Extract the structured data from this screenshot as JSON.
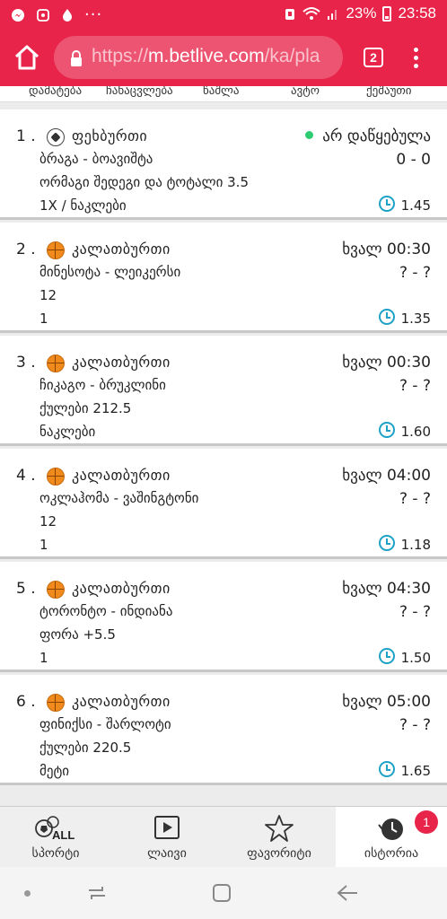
{
  "status_bar": {
    "dots": "···",
    "battery_percent": "23%",
    "time": "23:58"
  },
  "browser": {
    "url_scheme": "https://",
    "url_host": "m.betlive.com",
    "url_path": "/ka/pla",
    "tab_count": "2"
  },
  "sub_header": [
    "დამატება",
    "ჩანაცვლება",
    "წაშლა",
    "ავტო",
    "ქეშაუთი"
  ],
  "bets": [
    {
      "num": "1 .",
      "icon": "soccer-ball-icon",
      "sport": "ფეხბურთი",
      "time": "არ დაწყებულა",
      "live": true,
      "teams": "ბრაგა - ბოავიშტა",
      "score": "0 - 0",
      "market": "ორმაგი შედეგი და ტოტალი 3.5",
      "pick": "1X / ნაკლები",
      "odds": "1.45"
    },
    {
      "num": "2 .",
      "icon": "basketball-icon",
      "sport": "კალათბურთი",
      "time": "ხვალ 00:30",
      "live": false,
      "teams": "მინესოტა - ლეიკერსი",
      "score": "? - ?",
      "market": "12",
      "pick": "1",
      "odds": "1.35"
    },
    {
      "num": "3 .",
      "icon": "basketball-icon",
      "sport": "კალათბურთი",
      "time": "ხვალ 00:30",
      "live": false,
      "teams": "ჩიკაგო - ბრუკლინი",
      "score": "? - ?",
      "market": "ქულები 212.5",
      "pick": "ნაკლები",
      "odds": "1.60"
    },
    {
      "num": "4 .",
      "icon": "basketball-icon",
      "sport": "კალათბურთი",
      "time": "ხვალ 04:00",
      "live": false,
      "teams": "ოკლაჰომა - ვაშინგტონი",
      "score": "? - ?",
      "market": "12",
      "pick": "1",
      "odds": "1.18"
    },
    {
      "num": "5 .",
      "icon": "basketball-icon",
      "sport": "კალათბურთი",
      "time": "ხვალ 04:30",
      "live": false,
      "teams": "ტორონტო - ინდიანა",
      "score": "? - ?",
      "market": "ფორა +5.5",
      "pick": "1",
      "odds": "1.50"
    },
    {
      "num": "6 .",
      "icon": "basketball-icon",
      "sport": "კალათბურთი",
      "time": "ხვალ 05:00",
      "live": false,
      "teams": "ფინიქსი - შარლოტი",
      "score": "? - ?",
      "market": "ქულები 220.5",
      "pick": "მეტი",
      "odds": "1.65"
    }
  ],
  "bottom_nav": {
    "sports": "სპორტი",
    "sports_icon_text": "ALL",
    "live": "ლაივი",
    "favorites": "ფავორიტი",
    "history": "ისტორია",
    "history_badge": "1"
  },
  "colors": {
    "brand": "#e8244a",
    "clock": "#1ea2c7",
    "live_dot": "#2ecc71"
  }
}
